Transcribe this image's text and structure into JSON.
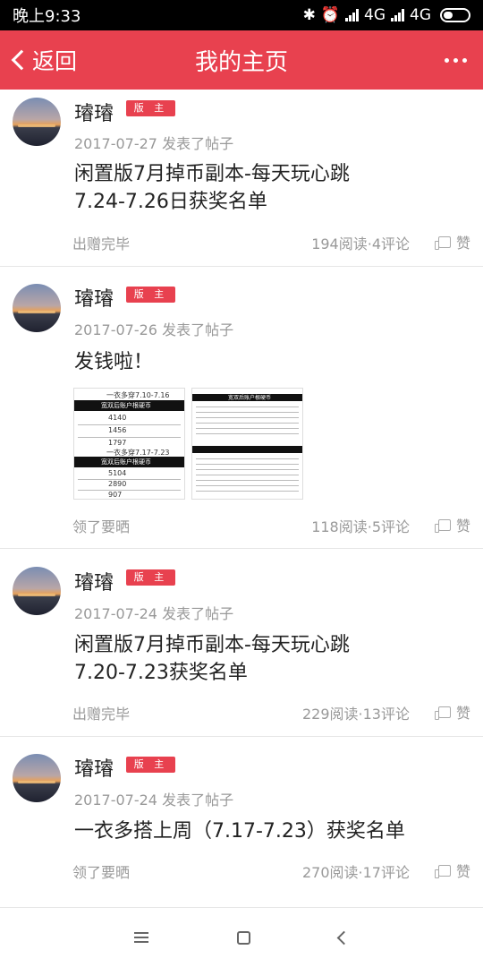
{
  "status_bar": {
    "time": "晚上9:33",
    "network_1": "4G",
    "network_2": "4G",
    "icons": [
      "bluetooth-icon",
      "alarm-icon",
      "hd-icon",
      "signal-icon",
      "signal-icon",
      "battery-icon"
    ]
  },
  "nav": {
    "back_label": "返回",
    "title": "我的主页",
    "more_icon": "more-dots-icon"
  },
  "posts": [
    {
      "author": "璿璿",
      "badge": "版 主",
      "meta": "2017-07-27 发表了帖子",
      "title_lines": [
        "闲置版7月掉币副本-每天玩心跳",
        "7.24-7.26日获奖名单"
      ],
      "tag": "出赠完毕",
      "stats": "194阅读·4评论",
      "like_label": "赞"
    },
    {
      "author": "璿璿",
      "badge": "版 主",
      "meta": "2017-07-26 发表了帖子",
      "title_lines": [
        "发钱啦！"
      ],
      "images": [
        {
          "heading1": "一衣多穿7.10-7.16",
          "header1": "宽双后账户根硬币",
          "values1": [
            "4140",
            "1456",
            "1797"
          ],
          "heading2": "一衣多穿7.17-7.23",
          "header2": "宽双后账户根硬币",
          "values2": [
            "5104",
            "2890",
            "907"
          ]
        },
        {
          "header": "宽双后账户根硬币"
        }
      ],
      "tag": "领了要晒",
      "stats": "118阅读·5评论",
      "like_label": "赞"
    },
    {
      "author": "璿璿",
      "badge": "版 主",
      "meta": "2017-07-24 发表了帖子",
      "title_lines": [
        "闲置版7月掉币副本-每天玩心跳",
        "7.20-7.23获奖名单"
      ],
      "tag": "出赠完毕",
      "stats": "229阅读·13评论",
      "like_label": "赞"
    },
    {
      "author": "璿璿",
      "badge": "版 主",
      "meta": "2017-07-24 发表了帖子",
      "title_lines": [
        "一衣多搭上周（7.17-7.23）获奖名单"
      ],
      "tag": "领了要晒",
      "stats": "270阅读·17评论",
      "like_label": "赞"
    }
  ],
  "bottom_nav": [
    "menu-icon",
    "home-icon",
    "back-icon"
  ]
}
